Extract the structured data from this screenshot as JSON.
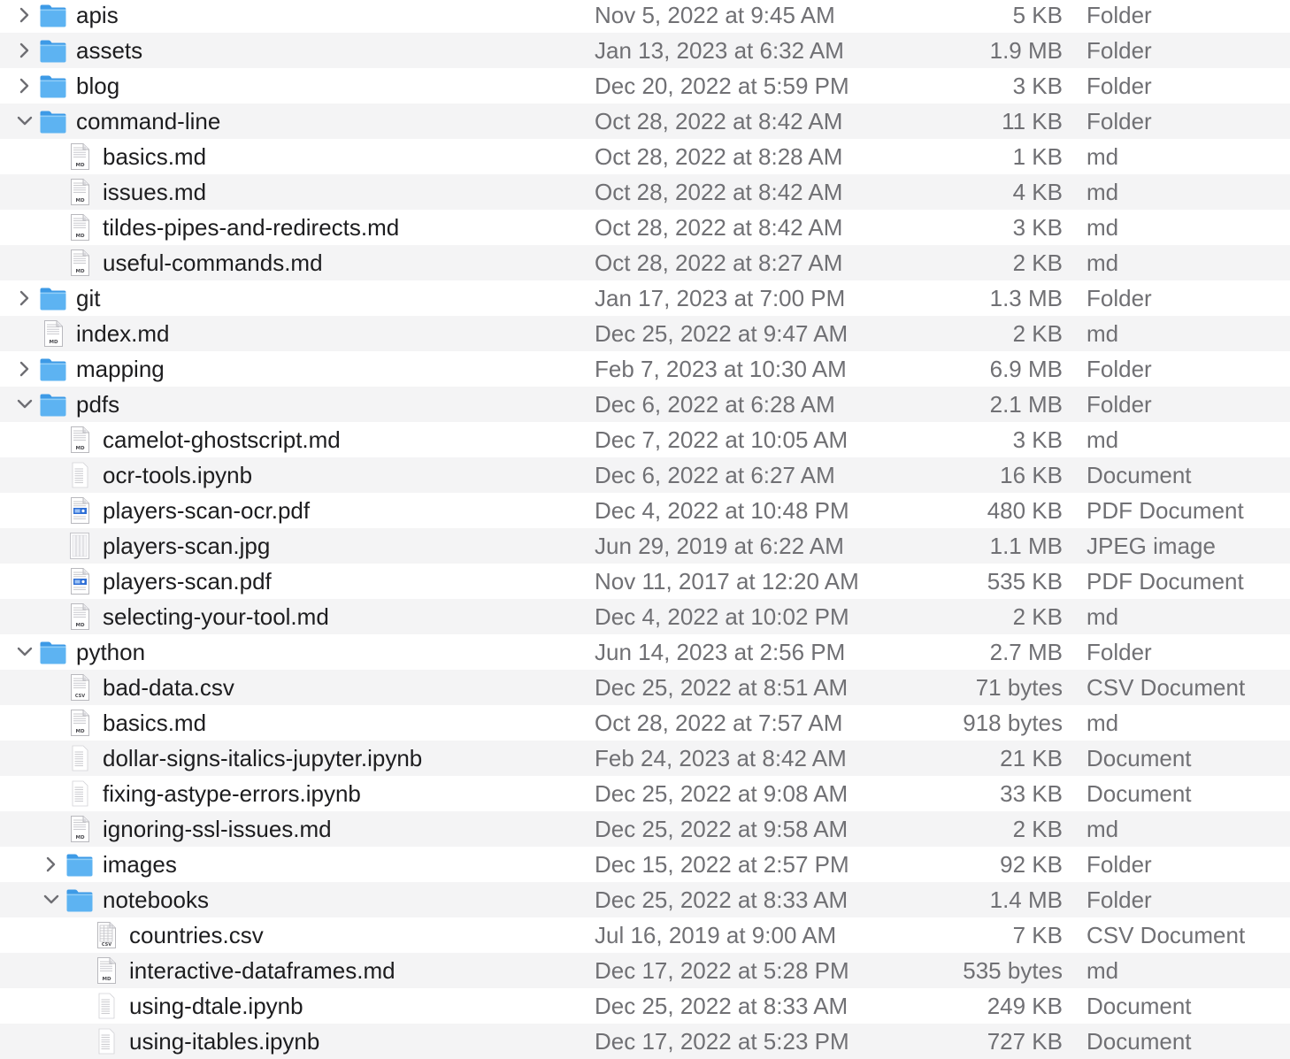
{
  "rows": [
    {
      "name": "apis",
      "date": "Nov 5, 2022 at 9:45 AM",
      "size": "5 KB",
      "kind": "Folder",
      "depth": 0,
      "type": "folder",
      "state": "collapsed",
      "icon": "folder-icon"
    },
    {
      "name": "assets",
      "date": "Jan 13, 2023 at 6:32 AM",
      "size": "1.9 MB",
      "kind": "Folder",
      "depth": 0,
      "type": "folder",
      "state": "collapsed",
      "icon": "folder-icon"
    },
    {
      "name": "blog",
      "date": "Dec 20, 2022 at 5:59 PM",
      "size": "3 KB",
      "kind": "Folder",
      "depth": 0,
      "type": "folder",
      "state": "collapsed",
      "icon": "folder-icon"
    },
    {
      "name": "command-line",
      "date": "Oct 28, 2022 at 8:42 AM",
      "size": "11 KB",
      "kind": "Folder",
      "depth": 0,
      "type": "folder",
      "state": "expanded",
      "icon": "folder-icon"
    },
    {
      "name": "basics.md",
      "date": "Oct 28, 2022 at 8:28 AM",
      "size": "1 KB",
      "kind": "md",
      "depth": 1,
      "type": "md",
      "icon": "markdown-file-icon"
    },
    {
      "name": "issues.md",
      "date": "Oct 28, 2022 at 8:42 AM",
      "size": "4 KB",
      "kind": "md",
      "depth": 1,
      "type": "md",
      "icon": "markdown-file-icon"
    },
    {
      "name": "tildes-pipes-and-redirects.md",
      "date": "Oct 28, 2022 at 8:42 AM",
      "size": "3 KB",
      "kind": "md",
      "depth": 1,
      "type": "md",
      "icon": "markdown-file-icon"
    },
    {
      "name": "useful-commands.md",
      "date": "Oct 28, 2022 at 8:27 AM",
      "size": "2 KB",
      "kind": "md",
      "depth": 1,
      "type": "md",
      "icon": "markdown-file-icon"
    },
    {
      "name": "git",
      "date": "Jan 17, 2023 at 7:00 PM",
      "size": "1.3 MB",
      "kind": "Folder",
      "depth": 0,
      "type": "folder",
      "state": "collapsed",
      "icon": "folder-icon"
    },
    {
      "name": "index.md",
      "date": "Dec 25, 2022 at 9:47 AM",
      "size": "2 KB",
      "kind": "md",
      "depth": 0,
      "type": "md",
      "icon": "markdown-file-icon"
    },
    {
      "name": "mapping",
      "date": "Feb 7, 2023 at 10:30 AM",
      "size": "6.9 MB",
      "kind": "Folder",
      "depth": 0,
      "type": "folder",
      "state": "collapsed",
      "icon": "folder-icon"
    },
    {
      "name": "pdfs",
      "date": "Dec 6, 2022 at 6:28 AM",
      "size": "2.1 MB",
      "kind": "Folder",
      "depth": 0,
      "type": "folder",
      "state": "expanded",
      "icon": "folder-icon"
    },
    {
      "name": "camelot-ghostscript.md",
      "date": "Dec 7, 2022 at 10:05 AM",
      "size": "3 KB",
      "kind": "md",
      "depth": 1,
      "type": "md",
      "icon": "markdown-file-icon"
    },
    {
      "name": "ocr-tools.ipynb",
      "date": "Dec 6, 2022 at 6:27 AM",
      "size": "16 KB",
      "kind": "Document",
      "depth": 1,
      "type": "doc",
      "icon": "document-icon"
    },
    {
      "name": "players-scan-ocr.pdf",
      "date": "Dec 4, 2022 at 10:48 PM",
      "size": "480 KB",
      "kind": "PDF Document",
      "depth": 1,
      "type": "pdf",
      "icon": "pdf-file-icon"
    },
    {
      "name": "players-scan.jpg",
      "date": "Jun 29, 2019 at 6:22 AM",
      "size": "1.1 MB",
      "kind": "JPEG image",
      "depth": 1,
      "type": "jpg",
      "icon": "image-thumbnail-icon"
    },
    {
      "name": "players-scan.pdf",
      "date": "Nov 11, 2017 at 12:20 AM",
      "size": "535 KB",
      "kind": "PDF Document",
      "depth": 1,
      "type": "pdf",
      "icon": "pdf-file-icon"
    },
    {
      "name": "selecting-your-tool.md",
      "date": "Dec 4, 2022 at 10:02 PM",
      "size": "2 KB",
      "kind": "md",
      "depth": 1,
      "type": "md",
      "icon": "markdown-file-icon"
    },
    {
      "name": "python",
      "date": "Jun 14, 2023 at 2:56 PM",
      "size": "2.7 MB",
      "kind": "Folder",
      "depth": 0,
      "type": "folder",
      "state": "expanded",
      "icon": "folder-icon"
    },
    {
      "name": "bad-data.csv",
      "date": "Dec 25, 2022 at 8:51 AM",
      "size": "71 bytes",
      "kind": "CSV Document",
      "depth": 1,
      "type": "csv",
      "icon": "csv-file-icon"
    },
    {
      "name": "basics.md",
      "date": "Oct 28, 2022 at 7:57 AM",
      "size": "918 bytes",
      "kind": "md",
      "depth": 1,
      "type": "md",
      "icon": "markdown-file-icon"
    },
    {
      "name": "dollar-signs-italics-jupyter.ipynb",
      "date": "Feb 24, 2023 at 8:42 AM",
      "size": "21 KB",
      "kind": "Document",
      "depth": 1,
      "type": "doc",
      "icon": "document-icon"
    },
    {
      "name": "fixing-astype-errors.ipynb",
      "date": "Dec 25, 2022 at 9:08 AM",
      "size": "33 KB",
      "kind": "Document",
      "depth": 1,
      "type": "doc",
      "icon": "document-icon"
    },
    {
      "name": "ignoring-ssl-issues.md",
      "date": "Dec 25, 2022 at 9:58 AM",
      "size": "2 KB",
      "kind": "md",
      "depth": 1,
      "type": "md",
      "icon": "markdown-file-icon"
    },
    {
      "name": "images",
      "date": "Dec 15, 2022 at 2:57 PM",
      "size": "92 KB",
      "kind": "Folder",
      "depth": 1,
      "type": "folder",
      "state": "collapsed",
      "icon": "folder-icon"
    },
    {
      "name": "notebooks",
      "date": "Dec 25, 2022 at 8:33 AM",
      "size": "1.4 MB",
      "kind": "Folder",
      "depth": 1,
      "type": "folder",
      "state": "expanded",
      "icon": "folder-icon"
    },
    {
      "name": "countries.csv",
      "date": "Jul 16, 2019 at 9:00 AM",
      "size": "7 KB",
      "kind": "CSV Document",
      "depth": 2,
      "type": "csvthumb",
      "icon": "csv-file-icon"
    },
    {
      "name": "interactive-dataframes.md",
      "date": "Dec 17, 2022 at 5:28 PM",
      "size": "535 bytes",
      "kind": "md",
      "depth": 2,
      "type": "md",
      "icon": "markdown-file-icon"
    },
    {
      "name": "using-dtale.ipynb",
      "date": "Dec 25, 2022 at 8:33 AM",
      "size": "249 KB",
      "kind": "Document",
      "depth": 2,
      "type": "doc",
      "icon": "document-icon"
    },
    {
      "name": "using-itables.ipynb",
      "date": "Dec 17, 2022 at 5:23 PM",
      "size": "727 KB",
      "kind": "Document",
      "depth": 2,
      "type": "doc",
      "icon": "document-icon"
    }
  ]
}
